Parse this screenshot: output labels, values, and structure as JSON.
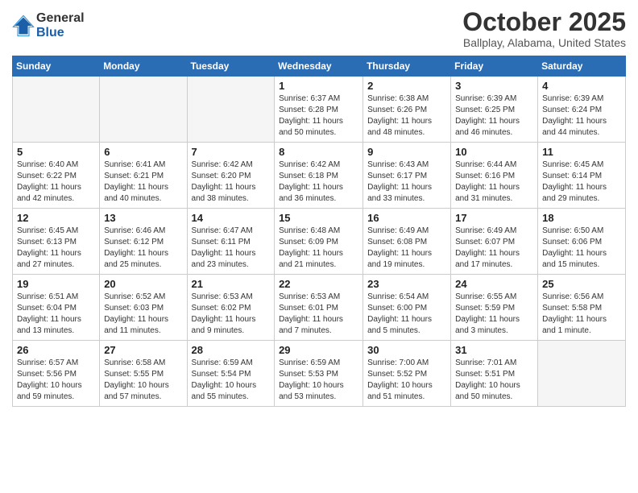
{
  "logo": {
    "general": "General",
    "blue": "Blue"
  },
  "title": "October 2025",
  "location": "Ballplay, Alabama, United States",
  "days_of_week": [
    "Sunday",
    "Monday",
    "Tuesday",
    "Wednesday",
    "Thursday",
    "Friday",
    "Saturday"
  ],
  "weeks": [
    [
      {
        "day": "",
        "info": ""
      },
      {
        "day": "",
        "info": ""
      },
      {
        "day": "",
        "info": ""
      },
      {
        "day": "1",
        "info": "Sunrise: 6:37 AM\nSunset: 6:28 PM\nDaylight: 11 hours\nand 50 minutes."
      },
      {
        "day": "2",
        "info": "Sunrise: 6:38 AM\nSunset: 6:26 PM\nDaylight: 11 hours\nand 48 minutes."
      },
      {
        "day": "3",
        "info": "Sunrise: 6:39 AM\nSunset: 6:25 PM\nDaylight: 11 hours\nand 46 minutes."
      },
      {
        "day": "4",
        "info": "Sunrise: 6:39 AM\nSunset: 6:24 PM\nDaylight: 11 hours\nand 44 minutes."
      }
    ],
    [
      {
        "day": "5",
        "info": "Sunrise: 6:40 AM\nSunset: 6:22 PM\nDaylight: 11 hours\nand 42 minutes."
      },
      {
        "day": "6",
        "info": "Sunrise: 6:41 AM\nSunset: 6:21 PM\nDaylight: 11 hours\nand 40 minutes."
      },
      {
        "day": "7",
        "info": "Sunrise: 6:42 AM\nSunset: 6:20 PM\nDaylight: 11 hours\nand 38 minutes."
      },
      {
        "day": "8",
        "info": "Sunrise: 6:42 AM\nSunset: 6:18 PM\nDaylight: 11 hours\nand 36 minutes."
      },
      {
        "day": "9",
        "info": "Sunrise: 6:43 AM\nSunset: 6:17 PM\nDaylight: 11 hours\nand 33 minutes."
      },
      {
        "day": "10",
        "info": "Sunrise: 6:44 AM\nSunset: 6:16 PM\nDaylight: 11 hours\nand 31 minutes."
      },
      {
        "day": "11",
        "info": "Sunrise: 6:45 AM\nSunset: 6:14 PM\nDaylight: 11 hours\nand 29 minutes."
      }
    ],
    [
      {
        "day": "12",
        "info": "Sunrise: 6:45 AM\nSunset: 6:13 PM\nDaylight: 11 hours\nand 27 minutes."
      },
      {
        "day": "13",
        "info": "Sunrise: 6:46 AM\nSunset: 6:12 PM\nDaylight: 11 hours\nand 25 minutes."
      },
      {
        "day": "14",
        "info": "Sunrise: 6:47 AM\nSunset: 6:11 PM\nDaylight: 11 hours\nand 23 minutes."
      },
      {
        "day": "15",
        "info": "Sunrise: 6:48 AM\nSunset: 6:09 PM\nDaylight: 11 hours\nand 21 minutes."
      },
      {
        "day": "16",
        "info": "Sunrise: 6:49 AM\nSunset: 6:08 PM\nDaylight: 11 hours\nand 19 minutes."
      },
      {
        "day": "17",
        "info": "Sunrise: 6:49 AM\nSunset: 6:07 PM\nDaylight: 11 hours\nand 17 minutes."
      },
      {
        "day": "18",
        "info": "Sunrise: 6:50 AM\nSunset: 6:06 PM\nDaylight: 11 hours\nand 15 minutes."
      }
    ],
    [
      {
        "day": "19",
        "info": "Sunrise: 6:51 AM\nSunset: 6:04 PM\nDaylight: 11 hours\nand 13 minutes."
      },
      {
        "day": "20",
        "info": "Sunrise: 6:52 AM\nSunset: 6:03 PM\nDaylight: 11 hours\nand 11 minutes."
      },
      {
        "day": "21",
        "info": "Sunrise: 6:53 AM\nSunset: 6:02 PM\nDaylight: 11 hours\nand 9 minutes."
      },
      {
        "day": "22",
        "info": "Sunrise: 6:53 AM\nSunset: 6:01 PM\nDaylight: 11 hours\nand 7 minutes."
      },
      {
        "day": "23",
        "info": "Sunrise: 6:54 AM\nSunset: 6:00 PM\nDaylight: 11 hours\nand 5 minutes."
      },
      {
        "day": "24",
        "info": "Sunrise: 6:55 AM\nSunset: 5:59 PM\nDaylight: 11 hours\nand 3 minutes."
      },
      {
        "day": "25",
        "info": "Sunrise: 6:56 AM\nSunset: 5:58 PM\nDaylight: 11 hours\nand 1 minute."
      }
    ],
    [
      {
        "day": "26",
        "info": "Sunrise: 6:57 AM\nSunset: 5:56 PM\nDaylight: 10 hours\nand 59 minutes."
      },
      {
        "day": "27",
        "info": "Sunrise: 6:58 AM\nSunset: 5:55 PM\nDaylight: 10 hours\nand 57 minutes."
      },
      {
        "day": "28",
        "info": "Sunrise: 6:59 AM\nSunset: 5:54 PM\nDaylight: 10 hours\nand 55 minutes."
      },
      {
        "day": "29",
        "info": "Sunrise: 6:59 AM\nSunset: 5:53 PM\nDaylight: 10 hours\nand 53 minutes."
      },
      {
        "day": "30",
        "info": "Sunrise: 7:00 AM\nSunset: 5:52 PM\nDaylight: 10 hours\nand 51 minutes."
      },
      {
        "day": "31",
        "info": "Sunrise: 7:01 AM\nSunset: 5:51 PM\nDaylight: 10 hours\nand 50 minutes."
      },
      {
        "day": "",
        "info": ""
      }
    ]
  ]
}
